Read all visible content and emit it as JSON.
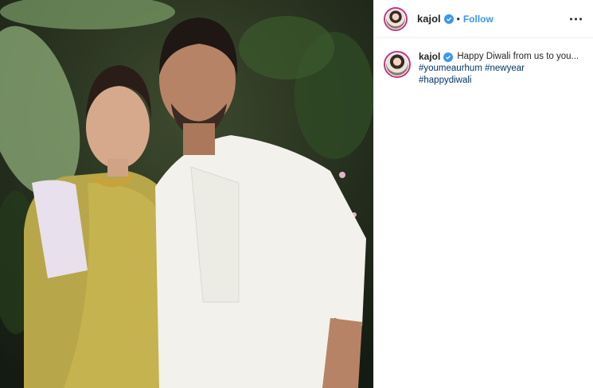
{
  "post": {
    "username": "kajol",
    "follow_label": "Follow",
    "separator": "•",
    "caption_text": "Happy Diwali from us to you...",
    "hashtags": [
      "#youmeaurhum",
      "#newyear",
      "#happydiwali"
    ]
  },
  "icons": {
    "verified": "verified-badge-icon",
    "more": "more-options-icon"
  },
  "colors": {
    "accent": "#3897f0",
    "hashtag": "#003569",
    "avatar_ring": "#c13584"
  }
}
